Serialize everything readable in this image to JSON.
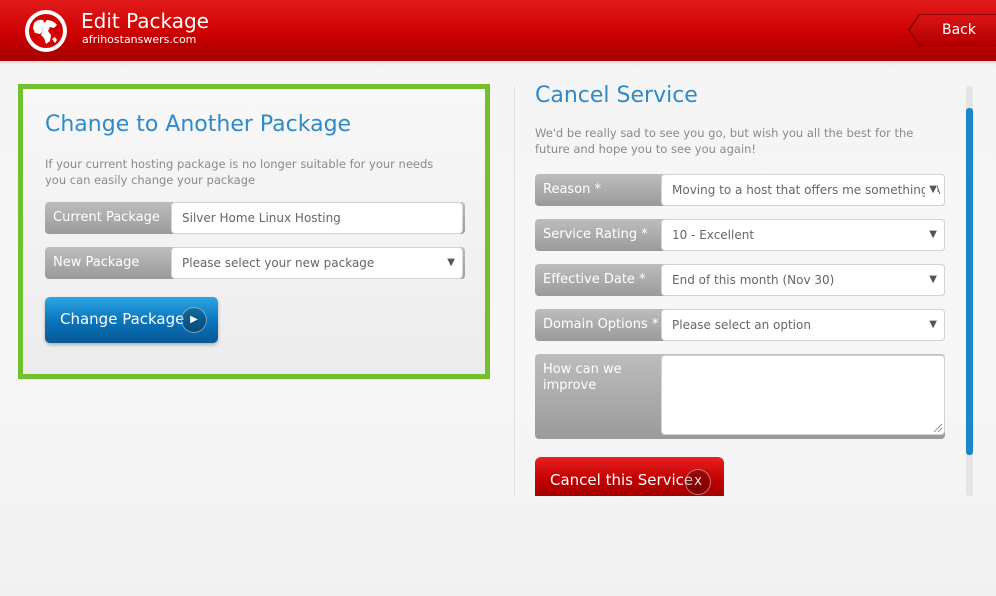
{
  "header": {
    "title": "Edit Package",
    "subtitle": "afrihostanswers.com",
    "back_label": "Back",
    "logo_icon": "globe-icon"
  },
  "change_package": {
    "title": "Change to Another Package",
    "description": "If your current hosting package is no longer suitable for your needs you can easily change your package",
    "current_label": "Current Package",
    "current_value": "Silver Home Linux Hosting",
    "new_label": "New Package",
    "new_placeholder": "Please select your new package",
    "button_label": "Change Package",
    "button_icon": "play-circle-icon",
    "highlight_color": "#72c02c"
  },
  "cancel_service": {
    "title": "Cancel Service",
    "description": "We'd be really sad to see you go, but wish you all the best for the future and hope you to see you again!",
    "fields": [
      {
        "label": "Reason *",
        "value": "Moving to a host that offers me something A"
      },
      {
        "label": "Service Rating *",
        "value": "10 - Excellent"
      },
      {
        "label": "Effective Date *",
        "value": "End of this month (Nov 30)"
      },
      {
        "label": "Domain Options *",
        "value": "Please select an option"
      }
    ],
    "improve_label": "How can we improve",
    "button_label": "Cancel this Service",
    "button_icon_text": "X"
  },
  "colors": {
    "brand_red": "#cc0000",
    "accent_blue": "#2f8ac7",
    "button_blue": "#0a72b8"
  }
}
